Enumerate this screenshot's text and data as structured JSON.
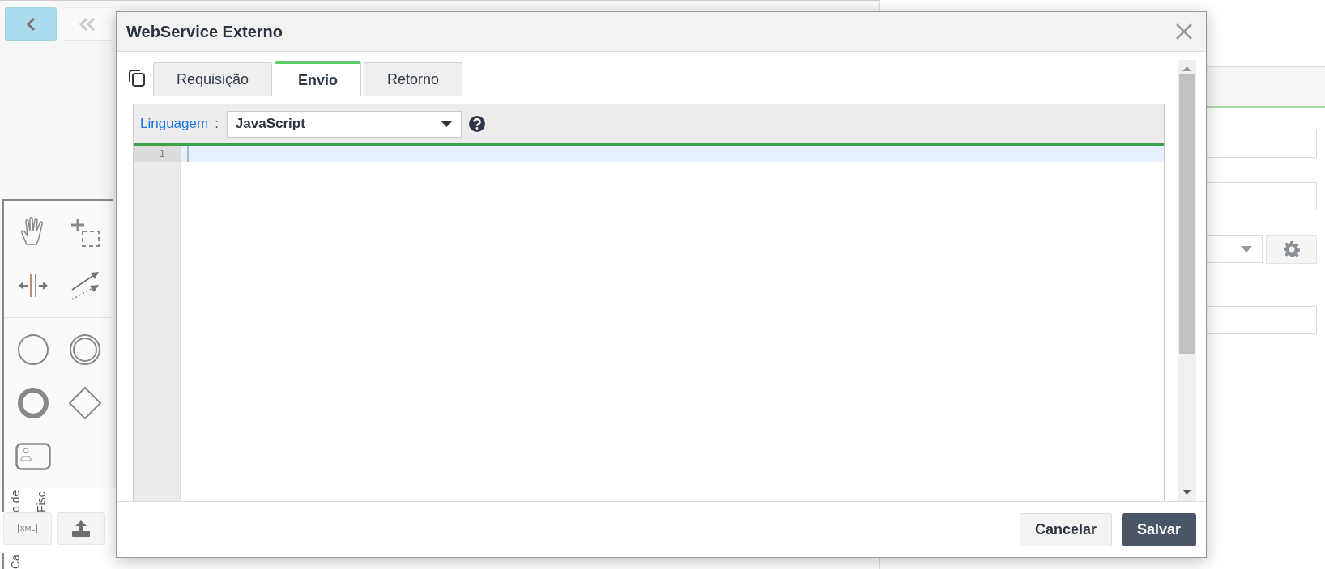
{
  "background": {
    "toolbar_buttons": [
      {
        "kind": "back",
        "selected": true
      },
      {
        "kind": "first",
        "selected": false
      }
    ],
    "palette_tools": [
      {
        "kind": "hand"
      },
      {
        "kind": "lasso"
      },
      {
        "kind": "space"
      },
      {
        "kind": "connect"
      },
      {
        "kind": "start-event"
      },
      {
        "kind": "intermediate-event"
      },
      {
        "kind": "end-event"
      },
      {
        "kind": "gateway"
      },
      {
        "kind": "user-task"
      }
    ],
    "vertical_labels": [
      "o de",
      "Fisc",
      "Ca"
    ],
    "bottom_buttons": [
      {
        "kind": "xml",
        "label": "XML"
      },
      {
        "kind": "upload"
      }
    ],
    "right_fields": [
      {
        "kind": "input"
      },
      {
        "kind": "input"
      },
      {
        "kind": "select"
      },
      {
        "kind": "input"
      }
    ]
  },
  "dialog": {
    "title": "WebService Externo",
    "tabs": [
      {
        "label": "Requisição",
        "selected": false
      },
      {
        "label": "Envio",
        "selected": true
      },
      {
        "label": "Retorno",
        "selected": false
      }
    ],
    "language": {
      "label": "Linguagem",
      "separator": ":",
      "value": "JavaScript"
    },
    "editor": {
      "line_numbers": [
        "1"
      ]
    },
    "buttons": [
      {
        "label": "Cancelar",
        "kind": "secondary"
      },
      {
        "label": "Salvar",
        "kind": "primary"
      }
    ]
  }
}
